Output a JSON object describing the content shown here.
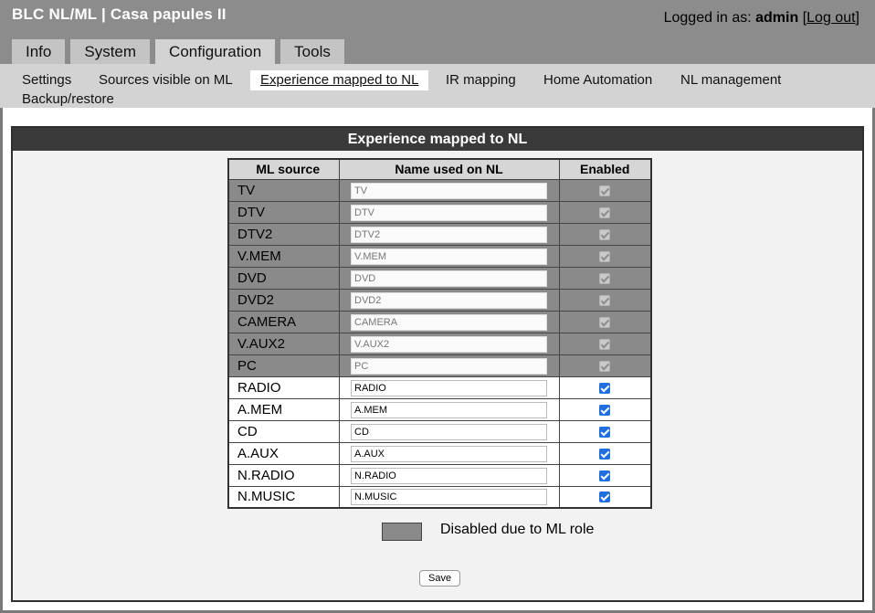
{
  "header": {
    "title": "BLC NL/ML | Casa papules II",
    "logged_in_prefix": "Logged in as:",
    "username": "admin",
    "logout_label": "Log out"
  },
  "tabs": [
    {
      "label": "Info"
    },
    {
      "label": "System"
    },
    {
      "label": "Configuration"
    },
    {
      "label": "Tools"
    }
  ],
  "subnav": [
    {
      "label": "Settings"
    },
    {
      "label": "Sources visible on ML"
    },
    {
      "label": "Experience mapped to NL"
    },
    {
      "label": "IR mapping"
    },
    {
      "label": "Home Automation"
    },
    {
      "label": "NL management"
    },
    {
      "label": "Backup/restore"
    }
  ],
  "panel": {
    "title": "Experience mapped to NL"
  },
  "table": {
    "headers": [
      "ML source",
      "Name used on NL",
      "Enabled"
    ],
    "rows": [
      {
        "source": "TV",
        "name": "TV",
        "enabled": true,
        "disabled": true
      },
      {
        "source": "DTV",
        "name": "DTV",
        "enabled": true,
        "disabled": true
      },
      {
        "source": "DTV2",
        "name": "DTV2",
        "enabled": true,
        "disabled": true
      },
      {
        "source": "V.MEM",
        "name": "V.MEM",
        "enabled": true,
        "disabled": true
      },
      {
        "source": "DVD",
        "name": "DVD",
        "enabled": true,
        "disabled": true
      },
      {
        "source": "DVD2",
        "name": "DVD2",
        "enabled": true,
        "disabled": true
      },
      {
        "source": "CAMERA",
        "name": "CAMERA",
        "enabled": true,
        "disabled": true
      },
      {
        "source": "V.AUX2",
        "name": "V.AUX2",
        "enabled": true,
        "disabled": true
      },
      {
        "source": "PC",
        "name": "PC",
        "enabled": true,
        "disabled": true
      },
      {
        "source": "RADIO",
        "name": "RADIO",
        "enabled": true,
        "disabled": false
      },
      {
        "source": "A.MEM",
        "name": "A.MEM",
        "enabled": true,
        "disabled": false
      },
      {
        "source": "CD",
        "name": "CD",
        "enabled": true,
        "disabled": false
      },
      {
        "source": "A.AUX",
        "name": "A.AUX",
        "enabled": true,
        "disabled": false
      },
      {
        "source": "N.RADIO",
        "name": "N.RADIO",
        "enabled": true,
        "disabled": false
      },
      {
        "source": "N.MUSIC",
        "name": "N.MUSIC",
        "enabled": true,
        "disabled": false
      }
    ]
  },
  "legend": {
    "text": "Disabled due to ML role",
    "color": "#8a8a8a"
  },
  "save_label": "Save",
  "colors": {
    "header_bg": "#8c8c8c",
    "panel_title_bg": "#3a3a3a",
    "checkbox_accent": "#1f6fe0"
  }
}
